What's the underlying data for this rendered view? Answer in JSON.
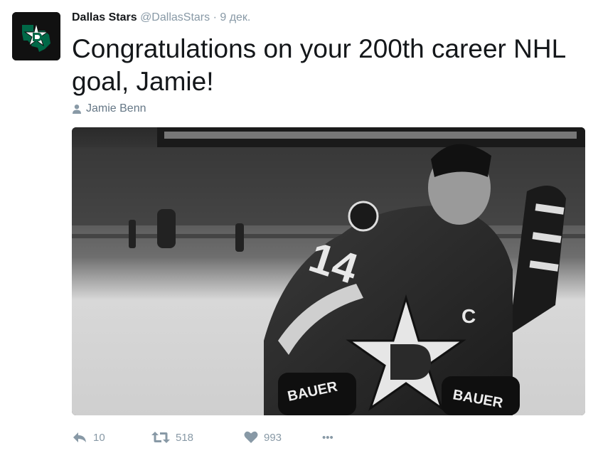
{
  "tweet": {
    "author": {
      "name": "Dallas Stars",
      "handle": "@DallasStars",
      "separator": "·",
      "date": "9 дек."
    },
    "text": "Congratulations on your 200th career NHL goal, Jamie!",
    "tagged_user": "Jamie Benn",
    "photo": {
      "jersey_number": "14",
      "captain_letter": "C",
      "glove_brand_left": "BAUER",
      "glove_brand_right": "BAUER"
    },
    "actions": {
      "reply_count": "10",
      "retweet_count": "518",
      "like_count": "993",
      "more_label": "•••"
    }
  },
  "icons": {
    "avatar": "dallas-stars-logo",
    "tagged": "user-icon",
    "reply": "reply-icon",
    "retweet": "retweet-icon",
    "like": "heart-icon",
    "more": "more-icon"
  },
  "colors": {
    "text": "#14171a",
    "secondary": "#8899a6",
    "tagged": "#657786",
    "logo_green": "#006847"
  }
}
